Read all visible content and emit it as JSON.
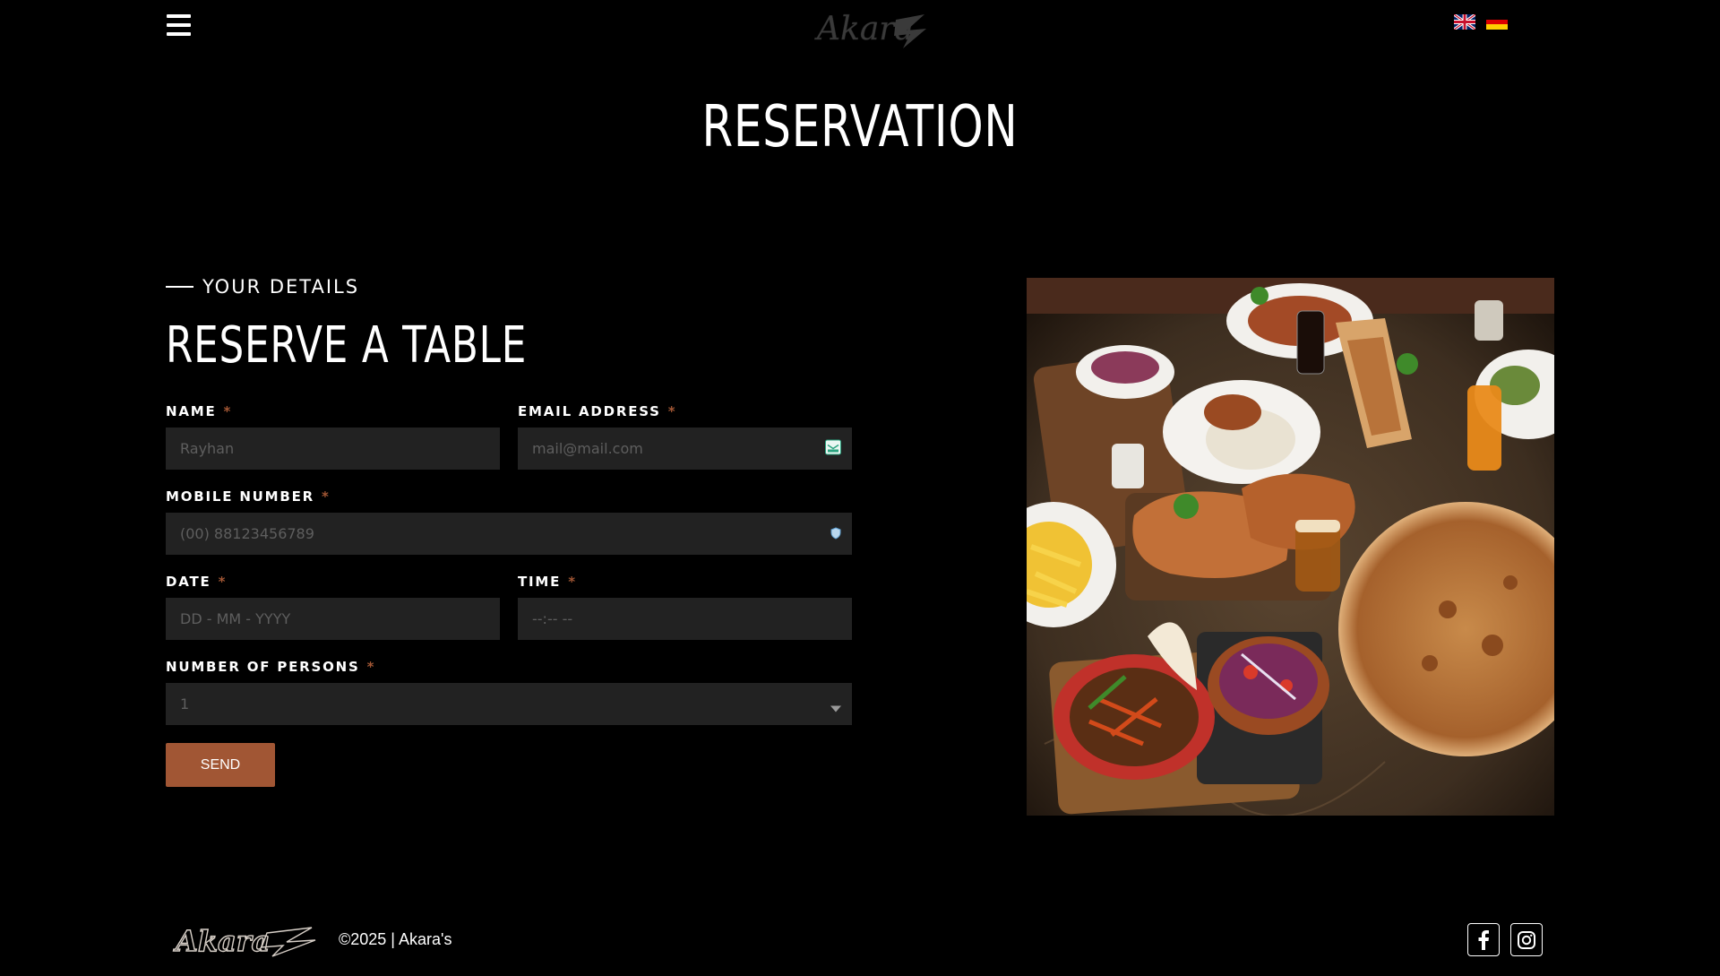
{
  "header": {
    "menu_icon": "hamburger-menu-icon",
    "logo_text": "Akara's",
    "languages": [
      {
        "code": "en",
        "icon": "uk-flag-icon"
      },
      {
        "code": "de",
        "icon": "germany-flag-icon"
      }
    ]
  },
  "page": {
    "title": "RESERVATION"
  },
  "form": {
    "eyebrow": "YOUR DETAILS",
    "title": "RESERVE A TABLE",
    "required_mark": "*",
    "name": {
      "label": "NAME",
      "placeholder": "Rayhan"
    },
    "email": {
      "label": "EMAIL ADDRESS",
      "placeholder": "mail@mail.com",
      "icon": "email-autofill-icon"
    },
    "mobile": {
      "label": "MOBILE NUMBER",
      "placeholder": "(00) 88123456789",
      "icon": "shield-icon"
    },
    "date": {
      "label": "DATE",
      "placeholder": "DD - MM - YYYY"
    },
    "time": {
      "label": "TIME",
      "placeholder": "--:-- --"
    },
    "persons": {
      "label": "NUMBER OF PERSONS",
      "value": "1",
      "icon": "chevron-down-icon"
    },
    "send_label": "SEND"
  },
  "image": {
    "subject": "food-platter-image"
  },
  "footer": {
    "logo_text": "Akara's",
    "copyright": "©2025 | Akara's",
    "social": [
      {
        "name": "facebook",
        "icon": "facebook-icon"
      },
      {
        "name": "instagram",
        "icon": "instagram-icon"
      }
    ]
  },
  "colors": {
    "background": "#000000",
    "field_bg": "#222222",
    "accent": "#a15634",
    "text": "#ffffff",
    "placeholder": "#5e5e5e"
  }
}
